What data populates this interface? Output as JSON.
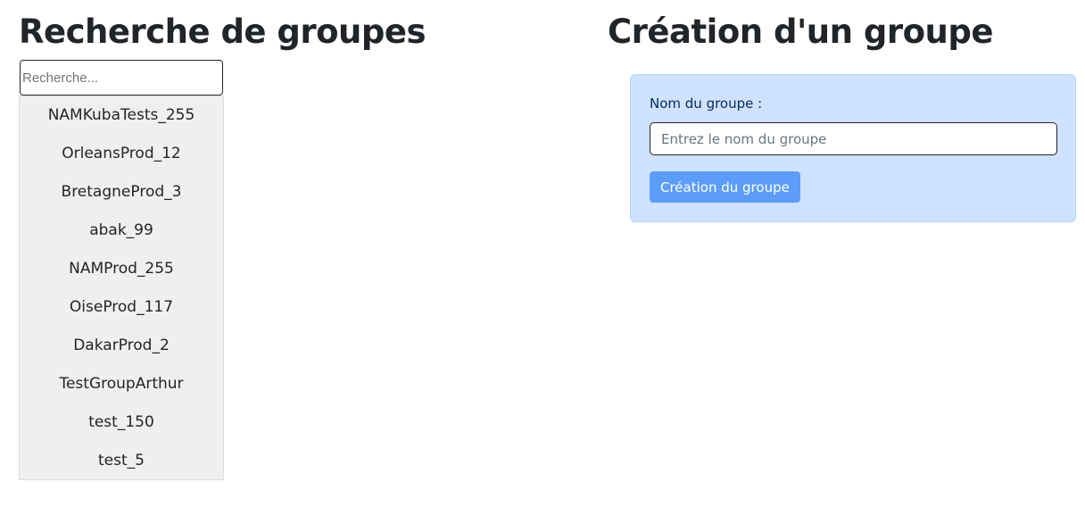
{
  "search": {
    "title": "Recherche de groupes",
    "placeholder": "Recherche...",
    "value": "",
    "results": [
      "NAMKubaTests_255",
      "OrleansProd_12",
      "BretagneProd_3",
      "abak_99",
      "NAMProd_255",
      "OiseProd_117",
      "DakarProd_2",
      "TestGroupArthur",
      "test_150",
      "test_5"
    ]
  },
  "create": {
    "title": "Création d'un groupe",
    "label": "Nom du groupe :",
    "placeholder": "Entrez le nom du groupe",
    "value": "",
    "button_label": "Création du groupe"
  },
  "colors": {
    "card_background": "#cfe2ff",
    "button": "#5c9dfc",
    "list_background": "#efefef"
  }
}
